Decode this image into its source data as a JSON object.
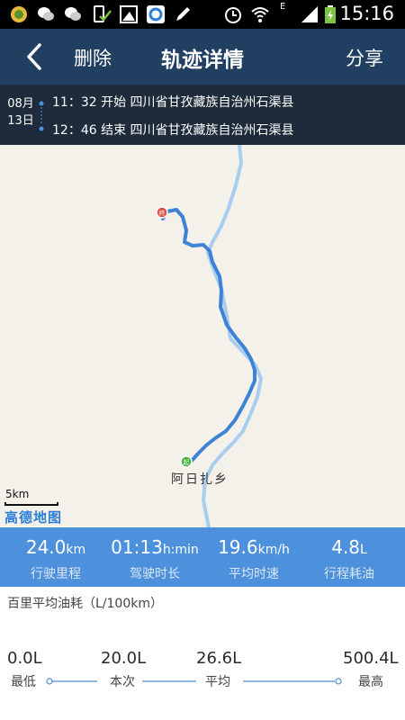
{
  "status_bar": {
    "time": "15:16",
    "network": "E"
  },
  "header": {
    "delete_label": "删除",
    "title": "轨迹详情",
    "share_label": "分享"
  },
  "trip": {
    "month": "08月",
    "day": "13日",
    "start_time": "11：32",
    "start_word": "开始",
    "start_place": "四川省甘孜藏族自治州石渠县",
    "end_time": "12：46",
    "end_word": "结束",
    "end_place": "四川省甘孜藏族自治州石渠县"
  },
  "map": {
    "place_label": "阿日扎乡",
    "scale_label": "5km",
    "provider_logo": "高德地图",
    "start_marker": "起",
    "end_marker": "终",
    "route_color": "#3e82d6",
    "river_color": "#a8cdef"
  },
  "stats": [
    {
      "value": "24.0",
      "unit": "km",
      "label": "行驶里程"
    },
    {
      "value": "01:13",
      "unit": "h:min",
      "label": "驾驶时长"
    },
    {
      "value": "19.6",
      "unit": "km/h",
      "label": "平均时速"
    },
    {
      "value": "4.8",
      "unit": "L",
      "label": "行程耗油"
    }
  ],
  "fuel": {
    "title": "百里平均油耗（L/100km）",
    "min": {
      "value": "0.0L",
      "label": "最低"
    },
    "current": {
      "value": "20.0L",
      "label": "本次"
    },
    "avg": {
      "value": "26.6L",
      "label": "平均"
    },
    "max": {
      "value": "500.4L",
      "label": "最高"
    }
  },
  "colors": {
    "header_bg": "#213f61",
    "trip_bg": "#1d2b3a",
    "stats_bg": "#4d90dc",
    "accent": "#4d90dc"
  }
}
